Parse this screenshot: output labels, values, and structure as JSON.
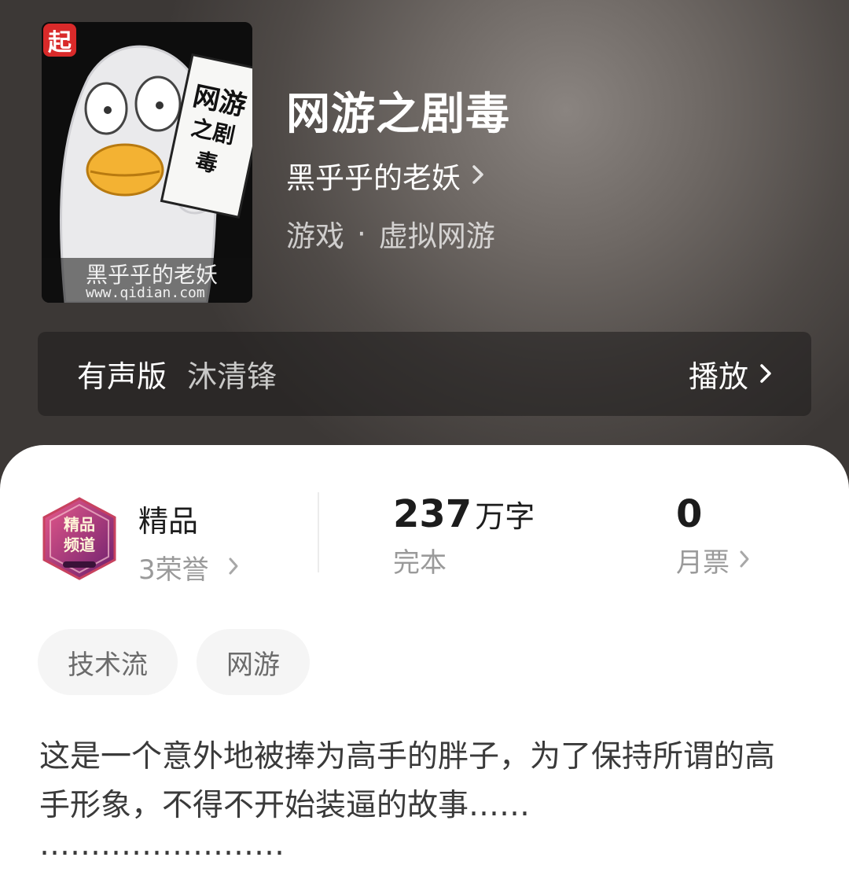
{
  "book": {
    "title": "网游之剧毒",
    "author": "黑乎乎的老妖",
    "genre": "游戏",
    "genre_separator": "·",
    "subgenre": "虚拟网游",
    "cover": {
      "logo_char": "起",
      "sign_text": [
        "网游",
        "之剧毒"
      ],
      "author_text": "黑乎乎的老妖",
      "site_text": "www.qidian.com"
    }
  },
  "audio": {
    "label": "有声版",
    "narrator": "沐清锋",
    "play_label": "播放"
  },
  "stats": {
    "badge": {
      "title": "精品",
      "honors": "3荣誉",
      "badge_text": [
        "精品",
        "频道"
      ]
    },
    "words": {
      "value": "237",
      "unit": "万字",
      "status": "完本"
    },
    "monthly_votes": {
      "value": "0",
      "label": "月票"
    }
  },
  "tags": [
    "技术流",
    "网游"
  ],
  "description": {
    "text": "这是一个意外地被捧为高手的胖子，为了保持所谓的高手形象，不得不开始装逼的故事……",
    "dots": "……………………"
  },
  "colors": {
    "header_bg": "#4f4a47",
    "logo_red": "#d92a2a",
    "badge_purple": "#8b2f7a",
    "tag_bg": "#f5f5f5"
  },
  "icons": {
    "chevron": "chevron-right-icon"
  }
}
